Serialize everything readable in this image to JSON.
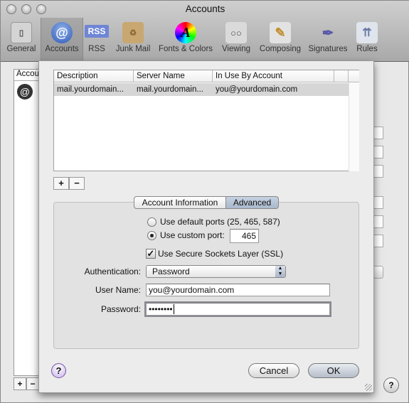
{
  "window": {
    "title": "Accounts"
  },
  "toolbar": [
    {
      "label": "General",
      "icon": "switch-icon"
    },
    {
      "label": "Accounts",
      "icon": "at-icon",
      "selected": true
    },
    {
      "label": "RSS",
      "icon": "rss-icon"
    },
    {
      "label": "Junk Mail",
      "icon": "junk-bag-icon"
    },
    {
      "label": "Fonts & Colors",
      "icon": "font-color-wheel-icon"
    },
    {
      "label": "Viewing",
      "icon": "glasses-icon"
    },
    {
      "label": "Composing",
      "icon": "pencil-paper-icon"
    },
    {
      "label": "Signatures",
      "icon": "pen-icon"
    },
    {
      "label": "Rules",
      "icon": "rules-arrows-icon"
    }
  ],
  "background": {
    "accounts_header": "Accounts",
    "add": "+",
    "remove": "−",
    "help": "?"
  },
  "sheet": {
    "table": {
      "columns": [
        "Description",
        "Server Name",
        "In Use By Account"
      ],
      "rows": [
        [
          "mail.yourdomain...",
          "mail.yourdomain...",
          "you@yourdomain.com"
        ]
      ]
    },
    "add": "+",
    "remove": "−",
    "tabs": [
      {
        "label": "Account Information"
      },
      {
        "label": "Advanced",
        "selected": true
      }
    ],
    "advanced": {
      "default_ports_label": "Use default ports (25, 465, 587)",
      "custom_port_label": "Use custom port:",
      "custom_port_value": "465",
      "port_mode": "custom",
      "ssl_label": "Use Secure Sockets Layer (SSL)",
      "ssl_checked": true,
      "auth_label": "Authentication:",
      "auth_value": "Password",
      "username_label": "User Name:",
      "username_value": "you@yourdomain.com",
      "password_label": "Password:",
      "password_value": "••••••••"
    },
    "help": "?",
    "cancel": "Cancel",
    "ok": "OK"
  },
  "colors": {
    "selected_tab": "#a9b8cc",
    "help_button": "#c9b2ee"
  }
}
